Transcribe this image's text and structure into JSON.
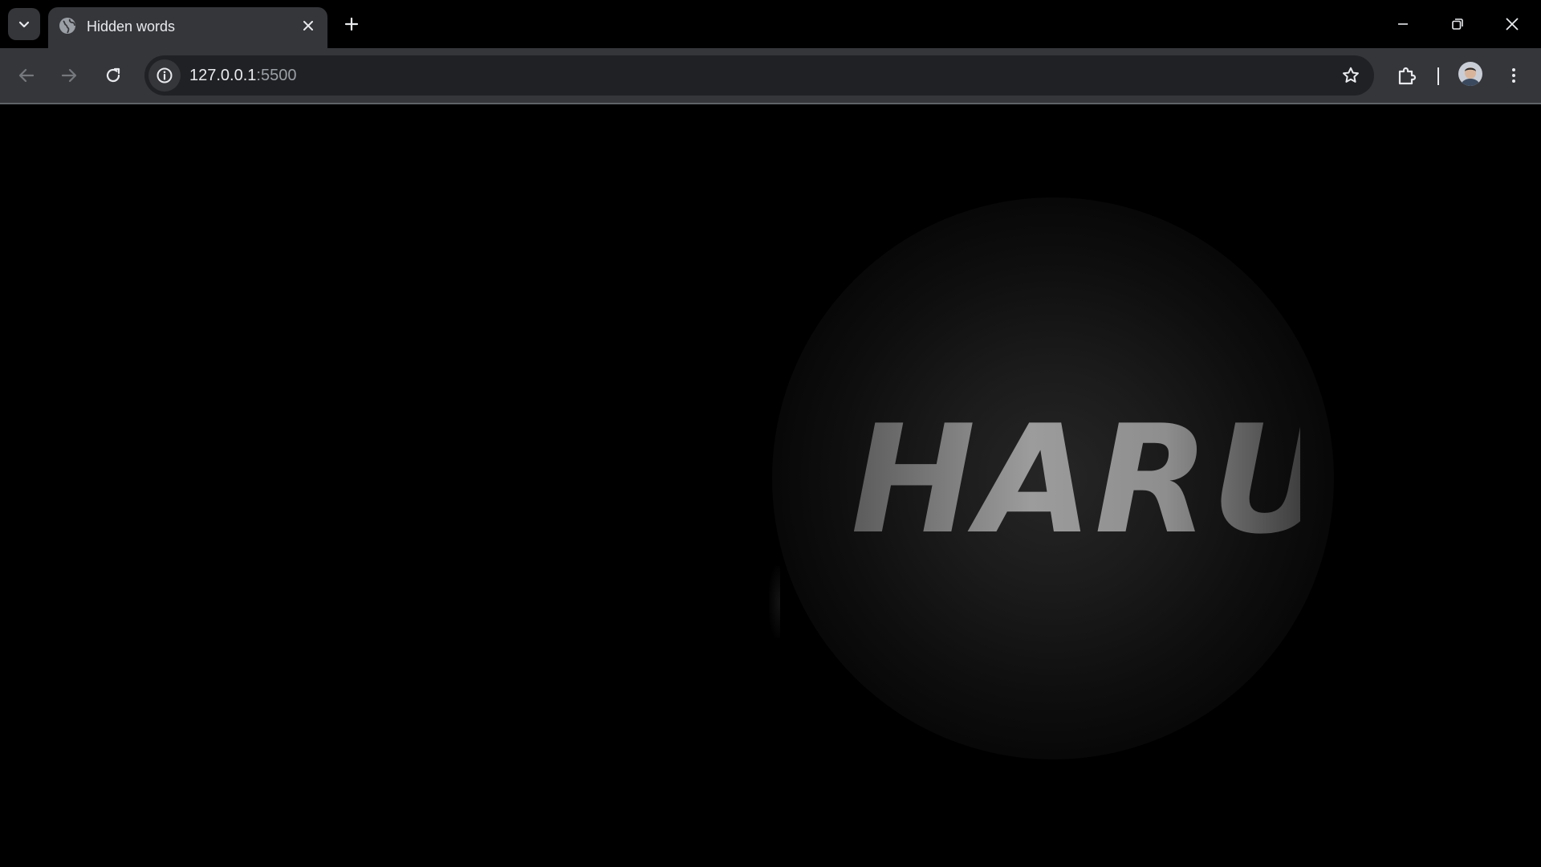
{
  "browser": {
    "tab": {
      "title": "Hidden words",
      "favicon": "globe-icon"
    },
    "omnibox": {
      "url_host": "127.0.0.1",
      "url_port": ":5500"
    },
    "icons": {
      "tab_search": "chevron-down-icon",
      "close_tab": "close-icon",
      "new_tab": "plus-icon",
      "minimize": "minimize-icon",
      "restore": "restore-icon",
      "close_window": "close-icon",
      "back": "arrow-left-icon",
      "forward": "arrow-right-icon",
      "reload": "reload-icon",
      "site_info": "info-icon",
      "bookmark": "star-icon",
      "extensions": "puzzle-icon",
      "menu": "more-vertical-icon"
    },
    "colors": {
      "tab_bg": "#35363a",
      "toolbar_bg": "#35363a",
      "omnibox_bg": "#202124",
      "text": "#e8eaed",
      "dim_text": "#9aa0a6"
    }
  },
  "page": {
    "background": "#000000",
    "hidden_word": "HARU"
  }
}
